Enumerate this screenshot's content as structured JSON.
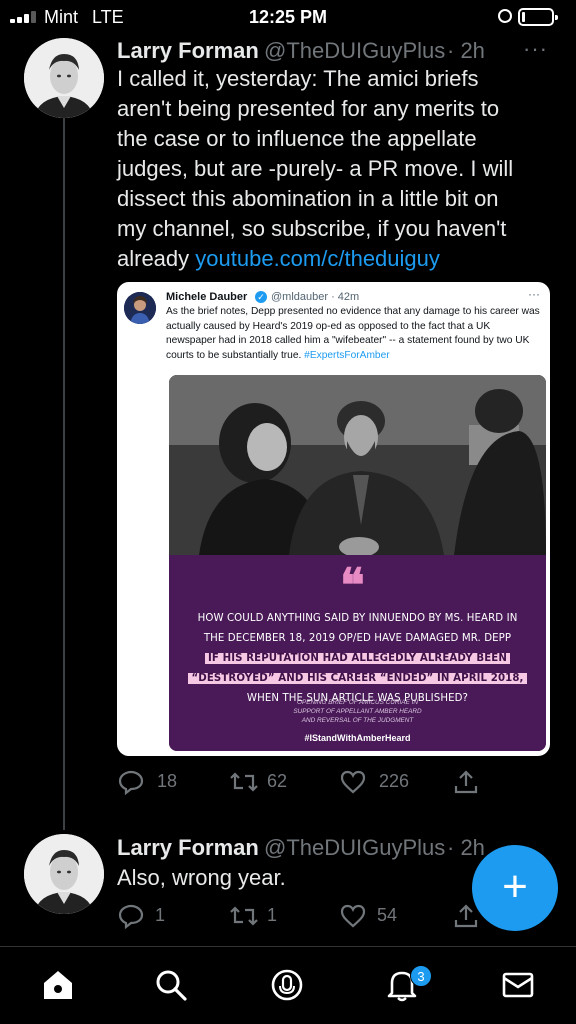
{
  "status_bar": {
    "carrier": "Mint",
    "network": "LTE",
    "time": "12:25 PM",
    "battery_level": 0.1
  },
  "tweet1": {
    "name": "Larry Forman",
    "handle": "@TheDUIGuyPlus",
    "time": "· 2h",
    "more": "···",
    "text": "I called it, yesterday: The amici briefs aren't being presented for any merits to the case or to influence the appellate judges, but are -purely- a PR move. I will dissect this abomination in a little bit on my channel, so subscribe, if you haven't already ",
    "link": "youtube.com/c/theduiguy",
    "quote": {
      "name": "Michele Dauber",
      "handle": "@mldauber · 42m",
      "more": "···",
      "text": "As the brief notes, Depp presented no evidence that any damage to his career was actually caused by Heard's 2019 op-ed as opposed to the fact that a UK newspaper had in 2018 called him a \"wifebeater\" -- a statement found by two UK courts to be substantially true. ",
      "hashtag": "#ExpertsForAmber",
      "image": {
        "quote_mark": "❝",
        "line1": "HOW COULD ANYTHING SAID BY INNUENDO BY MS. HEARD IN",
        "line2": "THE DECEMBER 18, 2019 OP/ED HAVE DAMAGED MR. DEPP",
        "hl1": "IF HIS REPUTATION HAD ALLEGEDLY ALREADY BEEN",
        "hl2": "“DESTROYED” AND HIS CAREER “ENDED” IN APRIL 2018,",
        "line3": "WHEN THE SUN ARTICLE WAS PUBLISHED?",
        "source1": "OPENING BRIEF OF AMICUS CURIAE IN",
        "source2": "SUPPORT OF APPELLANT AMBER HEARD",
        "source3": "AND REVERSAL OF THE JUDGMENT",
        "tag": "#IStandWithAmberHeard"
      }
    },
    "replies": "18",
    "retweets": "62",
    "likes": "226"
  },
  "tweet2": {
    "name": "Larry Forman",
    "handle": "@TheDUIGuyPlus",
    "time": "· 2h",
    "text": "Also, wrong year.",
    "replies": "1",
    "retweets": "1",
    "likes": "54"
  },
  "notifications_badge": "3",
  "icons": {
    "reply": "reply-icon",
    "retweet": "retweet-icon",
    "like": "heart-icon",
    "share": "share-icon",
    "compose": "plus-icon",
    "home": "home-icon",
    "search": "search-icon",
    "spaces": "microphone-icon",
    "notifications": "bell-icon",
    "messages": "mail-icon"
  },
  "colors": {
    "accent": "#1d9bf0",
    "background": "#000000",
    "secondary_text": "#71767b",
    "quote_panel": "#4a1a58",
    "highlight": "#f7c8e4"
  }
}
